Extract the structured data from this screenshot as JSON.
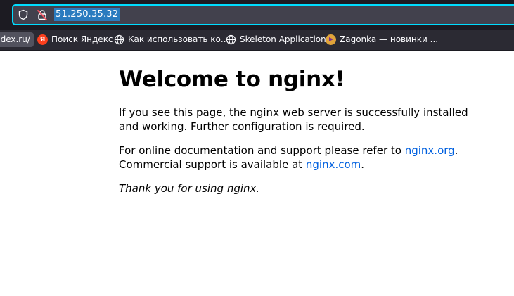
{
  "browser": {
    "url": "51.250.35.32",
    "bookmarks": [
      {
        "label": "ndex.ru/",
        "icon": "none",
        "active": true
      },
      {
        "label": "Поиск Яндекс",
        "icon": "yandex-icon"
      },
      {
        "label": "Как использовать ко...",
        "icon": "globe-icon"
      },
      {
        "label": "Skeleton Application",
        "icon": "globe-icon"
      },
      {
        "label": "Zagonka — новинки ...",
        "icon": "zagonka-icon"
      }
    ],
    "yandex_icon_letter": "Я"
  },
  "page": {
    "title": "Welcome to nginx!",
    "para1": "If you see this page, the nginx web server is successfully installed and working. Further configuration is required.",
    "para2_text1": "For online documentation and support please refer to ",
    "para2_link1": "nginx.org",
    "para2_text2": ".",
    "para2_text3": "Commercial support is available at ",
    "para2_link2": "nginx.com",
    "para2_text4": ".",
    "para3": "Thank you for using nginx."
  },
  "colors": {
    "chrome_bg": "#2b2a33",
    "url_bar_bg": "#42414d",
    "url_focus_border": "#00ddff",
    "url_selection": "#2a7bbf",
    "link": "#0060df"
  }
}
